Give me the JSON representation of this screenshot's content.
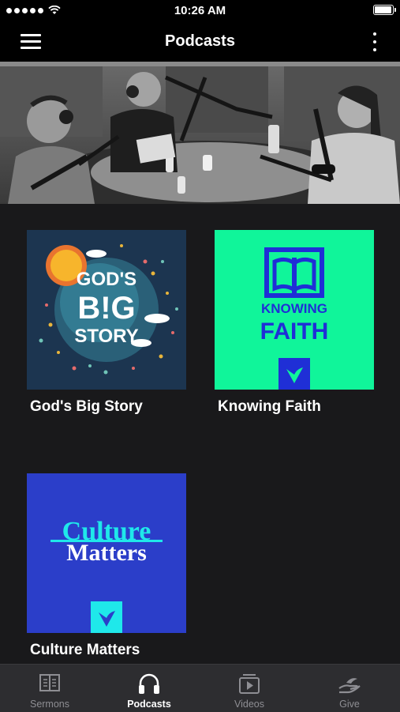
{
  "status_bar": {
    "time": "10:26 AM",
    "battery_level": 1.0
  },
  "nav_bar": {
    "title": "Podcasts"
  },
  "podcasts": [
    {
      "title": "God's Big Story",
      "art_lines": [
        "GOD'S",
        "B!G",
        "STORY"
      ]
    },
    {
      "title": "Knowing Faith",
      "art_lines": [
        "KNOWING",
        "FAITH"
      ]
    },
    {
      "title": "Culture Matters",
      "art_lines": [
        "Culture",
        "Matters"
      ]
    }
  ],
  "tab_bar": {
    "tabs": [
      {
        "label": "Sermons",
        "icon": "book-icon",
        "active": false
      },
      {
        "label": "Podcasts",
        "icon": "headphones-icon",
        "active": true
      },
      {
        "label": "Videos",
        "icon": "video-play-icon",
        "active": false
      },
      {
        "label": "Give",
        "icon": "giving-hand-icon",
        "active": false
      }
    ]
  },
  "colors": {
    "background": "#19191b",
    "bar": "#000000",
    "tab_bar": "#2d2d30",
    "knowing_faith_bg": "#10f59a",
    "knowing_faith_ink": "#1f2fd6",
    "culture_matters_bg": "#2b3ec9",
    "culture_matters_accent": "#1fe8ea",
    "gods_big_story_bg": "#1c3550"
  }
}
